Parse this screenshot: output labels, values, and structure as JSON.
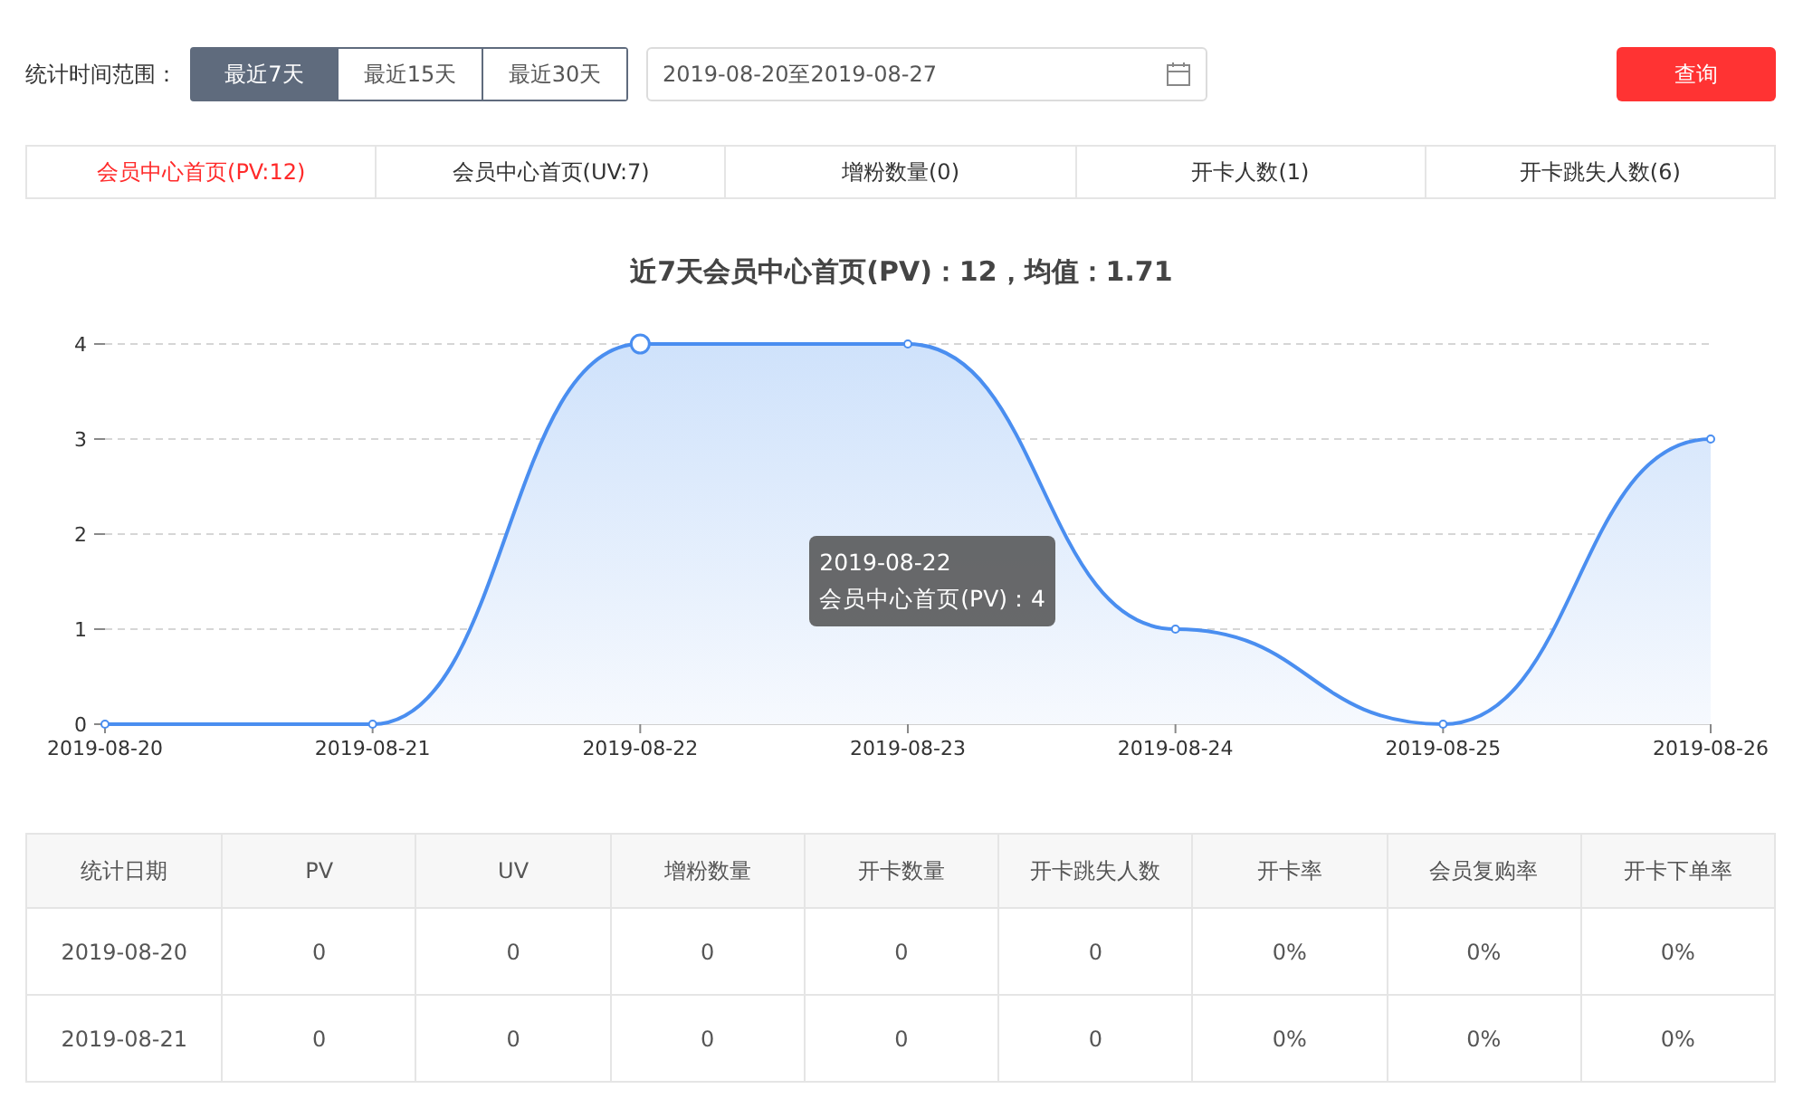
{
  "filter": {
    "label": "统计时间范围：",
    "ranges": [
      {
        "label": "最近7天",
        "selected": true
      },
      {
        "label": "最近15天",
        "selected": false
      },
      {
        "label": "最近30天",
        "selected": false
      }
    ],
    "date_range": {
      "value": "2019-08-20至2019-08-27"
    },
    "query_button": "查询"
  },
  "metric_tabs": [
    {
      "label": "会员中心首页(PV:12)",
      "selected": true
    },
    {
      "label": "会员中心首页(UV:7)",
      "selected": false
    },
    {
      "label": "增粉数量(0)",
      "selected": false
    },
    {
      "label": "开卡人数(1)",
      "selected": false
    },
    {
      "label": "开卡跳失人数(6)",
      "selected": false
    }
  ],
  "chart": {
    "chart_data": {
      "type": "area",
      "title": "近7天会员中心首页(PV)：12，均值：1.71",
      "categories": [
        "2019-08-20",
        "2019-08-21",
        "2019-08-22",
        "2019-08-23",
        "2019-08-24",
        "2019-08-25",
        "2019-08-26"
      ],
      "series": [
        {
          "name": "会员中心首页(PV)",
          "color": "#4a8ef0",
          "values": [
            0,
            0,
            4,
            4,
            1,
            0,
            3
          ]
        }
      ],
      "ylim": [
        0,
        4
      ],
      "yticks": [
        0,
        1,
        2,
        3,
        4
      ],
      "grid": true
    },
    "tooltip": {
      "x": "2019-08-22",
      "separator": "：",
      "value": "4"
    }
  },
  "table": {
    "columns": [
      "统计日期",
      "PV",
      "UV",
      "增粉数量",
      "开卡数量",
      "开卡跳失人数",
      "开卡率",
      "会员复购率",
      "开卡下单率"
    ],
    "rows": [
      [
        "2019-08-20",
        "0",
        "0",
        "0",
        "0",
        "0",
        "0%",
        "0%",
        "0%"
      ],
      [
        "2019-08-21",
        "0",
        "0",
        "0",
        "0",
        "0",
        "0%",
        "0%",
        "0%"
      ]
    ]
  }
}
